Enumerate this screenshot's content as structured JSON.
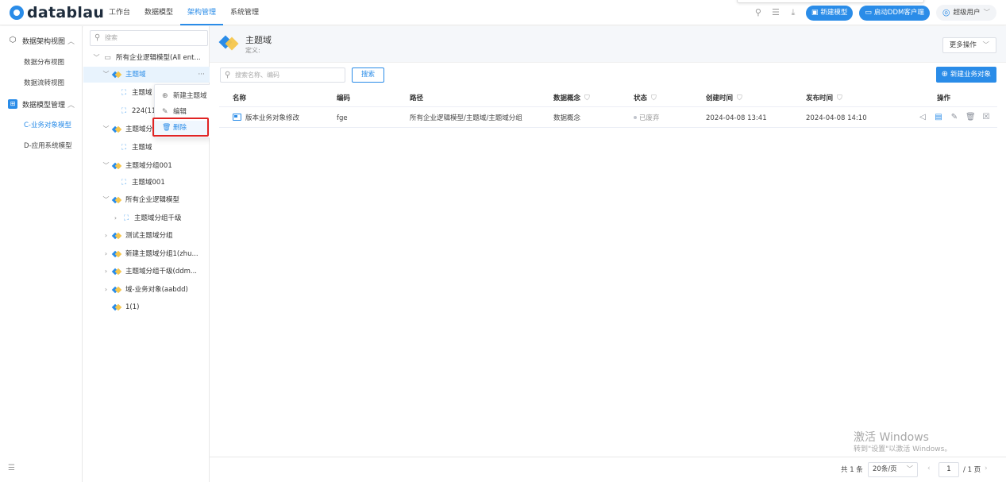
{
  "app": {
    "logo_text": "datablau"
  },
  "nav": {
    "items": [
      {
        "label": "工作台"
      },
      {
        "label": "数据模型"
      },
      {
        "label": "架构管理"
      },
      {
        "label": "系统管理"
      }
    ],
    "active_index": 2
  },
  "top_right": {
    "new_model_label": "新建模型",
    "launch_ddm_label": "启动DDM客户端",
    "user_label": "超级用户"
  },
  "sidebar": {
    "group1_label": "数据架构视图",
    "group1_items": [
      "数据分布视图",
      "数据流转视图"
    ],
    "group2_label": "数据模型管理",
    "group2_items": [
      "C-业务对象模型",
      "D-应用系统模型"
    ],
    "active_item": "C-业务对象模型"
  },
  "tree": {
    "search_placeholder": "搜索",
    "root_label": "所有企业逻辑模型(All ent...",
    "nodes": [
      "主题域",
      "主题域",
      "224(11",
      "主题域分",
      "主题域",
      "主题域分组001",
      "主题域001",
      "所有企业逻辑模型",
      "主题域分组千级",
      "测试主题域分组",
      "新建主题域分组1(zhu...",
      "主题域分组千级(ddm...",
      "域-业务对象(aabdd)",
      "1(1)"
    ],
    "more_glyph": "···"
  },
  "context_menu": {
    "items": [
      "新建主题域",
      "编辑",
      "删除"
    ]
  },
  "main": {
    "title": "主题域",
    "definition_label": "定义:",
    "more_ops_label": "更多操作",
    "search_placeholder": "搜索名称、编码",
    "search_button": "搜索",
    "new_object_button": "新建业务对象",
    "columns": [
      "名称",
      "编码",
      "路径",
      "数据概念",
      "状态",
      "创建时间",
      "发布时间",
      "操作"
    ],
    "rows": [
      {
        "name": "版本业务对象修改",
        "code": "fge",
        "path": "所有企业逻辑模型/主题域/主题域分组",
        "concept": "数据概念",
        "status": "已废弃",
        "created": "2024-04-08 13:41",
        "published": "2024-04-08 14:10"
      }
    ]
  },
  "pagination": {
    "total": "共 1 条",
    "page_size": "20条/页",
    "current_page": "1",
    "total_pages": "/ 1 页"
  },
  "watermark": {
    "line1": "激活 Windows",
    "line2": "转到\"设置\"以激活 Windows。"
  },
  "colors": {
    "accent": "#2a8ce8",
    "highlight_box": "#e02424",
    "brand_secondary": "#f5c64c"
  }
}
